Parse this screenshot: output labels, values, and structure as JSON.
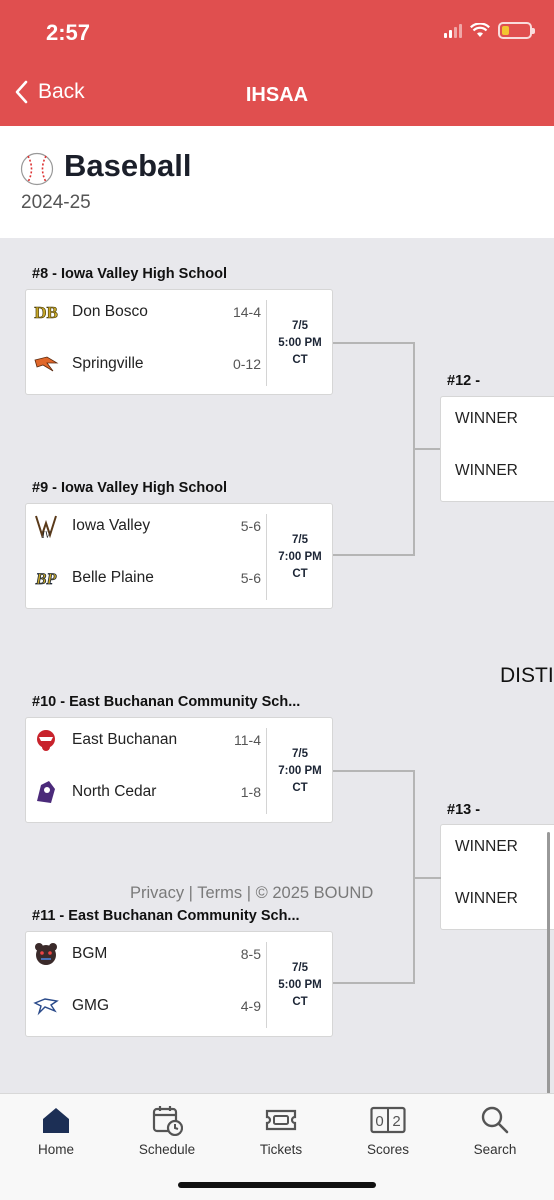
{
  "status_bar": {
    "time": "2:57"
  },
  "nav": {
    "back_label": "Back",
    "title": "IHSAA"
  },
  "page": {
    "sport": "Baseball",
    "season": "2024-25"
  },
  "games": [
    {
      "label": "#8 - Iowa Valley High School",
      "teams": [
        {
          "name": "Don Bosco",
          "record": "14-4",
          "logo": "don-bosco-logo"
        },
        {
          "name": "Springville",
          "record": "0-12",
          "logo": "springville-logo"
        }
      ],
      "date": "7/5",
      "time": "5:00 PM",
      "tz": "CT"
    },
    {
      "label": "#9 - Iowa Valley High School",
      "teams": [
        {
          "name": "Iowa Valley",
          "record": "5-6",
          "logo": "iowa-valley-logo"
        },
        {
          "name": "Belle Plaine",
          "record": "5-6",
          "logo": "belle-plaine-logo"
        }
      ],
      "date": "7/5",
      "time": "7:00 PM",
      "tz": "CT"
    },
    {
      "label": "#10 - East Buchanan Community Sch...",
      "teams": [
        {
          "name": "East Buchanan",
          "record": "11-4",
          "logo": "east-buchanan-logo"
        },
        {
          "name": "North Cedar",
          "record": "1-8",
          "logo": "north-cedar-logo"
        }
      ],
      "date": "7/5",
      "time": "7:00 PM",
      "tz": "CT"
    },
    {
      "label": "#11 - East Buchanan Community Sch...",
      "teams": [
        {
          "name": "BGM",
          "record": "8-5",
          "logo": "bgm-logo"
        },
        {
          "name": "GMG",
          "record": "4-9",
          "logo": "gmg-logo"
        }
      ],
      "date": "7/5",
      "time": "5:00 PM",
      "tz": "CT"
    }
  ],
  "next_round": [
    {
      "label": "#12 -",
      "rows": [
        "WINNER",
        "WINNER"
      ]
    },
    {
      "label": "#13 -",
      "rows": [
        "WINNER",
        "WINNER"
      ]
    }
  ],
  "district_label": "DISTI",
  "footer": "Privacy | Terms | © 2025 BOUND",
  "tabs": [
    {
      "label": "Home",
      "icon": "home-icon",
      "active": true
    },
    {
      "label": "Schedule",
      "icon": "calendar-clock-icon"
    },
    {
      "label": "Tickets",
      "icon": "ticket-icon"
    },
    {
      "label": "Scores",
      "icon": "scoreboard-icon"
    },
    {
      "label": "Search",
      "icon": "search-icon"
    }
  ],
  "colors": {
    "header_red": "#e04f4f",
    "navy": "#1c2535",
    "battery": "#f2c531"
  }
}
